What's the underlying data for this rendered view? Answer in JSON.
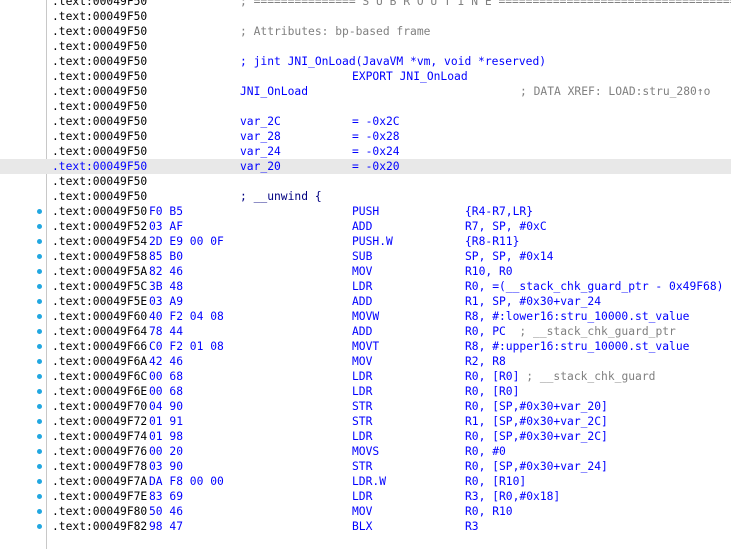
{
  "colors": {
    "address": "#000000",
    "instruction": "#0000ff",
    "comment": "#808080",
    "highlight_row": "#e8e8e8",
    "breakpoint_dot": "#22a7e0"
  },
  "rows": [
    {
      "kind": "text",
      "addr": ".text:00049F50",
      "text": "; =============== S U B R O U T I N E =======================================",
      "cls": "c-gray"
    },
    {
      "kind": "blank",
      "addr": ".text:00049F50"
    },
    {
      "kind": "text",
      "addr": ".text:00049F50",
      "text": "; Attributes: bp-based frame",
      "cls": "c-gray"
    },
    {
      "kind": "blank",
      "addr": ".text:00049F50"
    },
    {
      "kind": "text",
      "addr": ".text:00049F50",
      "text": "; jint JNI_OnLoad(JavaVM *vm, void *reserved)",
      "cls": "c-blue"
    },
    {
      "kind": "instr",
      "addr": ".text:00049F50",
      "bytes": "",
      "mnem": "EXPORT JNI_OnLoad",
      "ops": ""
    },
    {
      "kind": "label",
      "addr": ".text:00049F50",
      "label": "JNI_OnLoad",
      "xref": "; DATA XREF: LOAD:stru_280↑o"
    },
    {
      "kind": "blank",
      "addr": ".text:00049F50"
    },
    {
      "kind": "var",
      "addr": ".text:00049F50",
      "name": "var_2C",
      "val": "= -0x2C"
    },
    {
      "kind": "var",
      "addr": ".text:00049F50",
      "name": "var_28",
      "val": "= -0x28"
    },
    {
      "kind": "var",
      "addr": ".text:00049F50",
      "name": "var_24",
      "val": "= -0x24"
    },
    {
      "kind": "var",
      "addr": ".text:00049F50",
      "name": "var_20",
      "val": "= -0x20",
      "hl": true
    },
    {
      "kind": "blank",
      "addr": ".text:00049F50"
    },
    {
      "kind": "text",
      "addr": ".text:00049F50",
      "text": "; __unwind {",
      "cls": "c-navy"
    },
    {
      "kind": "instr",
      "addr": ".text:00049F50",
      "bytes": "F0 B5",
      "mnem": "PUSH",
      "ops": "{R4-R7,LR}",
      "bp": true
    },
    {
      "kind": "instr",
      "addr": ".text:00049F52",
      "bytes": "03 AF",
      "mnem": "ADD",
      "ops": "R7, SP, #0xC",
      "bp": true
    },
    {
      "kind": "instr",
      "addr": ".text:00049F54",
      "bytes": "2D E9 00 0F",
      "mnem": "PUSH.W",
      "ops": "{R8-R11}",
      "bp": true
    },
    {
      "kind": "instr",
      "addr": ".text:00049F58",
      "bytes": "85 B0",
      "mnem": "SUB",
      "ops": "SP, SP, #0x14",
      "bp": true
    },
    {
      "kind": "instr",
      "addr": ".text:00049F5A",
      "bytes": "82 46",
      "mnem": "MOV",
      "ops": "R10, R0",
      "bp": true
    },
    {
      "kind": "instr",
      "addr": ".text:00049F5C",
      "bytes": "3B 48",
      "mnem": "LDR",
      "ops": "R0, =(__stack_chk_guard_ptr - 0x49F68)",
      "bp": true
    },
    {
      "kind": "instr",
      "addr": ".text:00049F5E",
      "bytes": "03 A9",
      "mnem": "ADD",
      "ops": "R1, SP, #0x30+var_24",
      "bp": true
    },
    {
      "kind": "instr",
      "addr": ".text:00049F60",
      "bytes": "40 F2 04 08",
      "mnem": "MOVW",
      "ops": "R8, #:lower16:stru_10000.st_value",
      "bp": true
    },
    {
      "kind": "instr",
      "addr": ".text:00049F64",
      "bytes": "78 44",
      "mnem": "ADD",
      "ops": "R0, PC",
      "cm": "  ; __stack_chk_guard_ptr",
      "bp": true
    },
    {
      "kind": "instr",
      "addr": ".text:00049F66",
      "bytes": "C0 F2 01 08",
      "mnem": "MOVT",
      "ops": "R8, #:upper16:stru_10000.st_value",
      "bp": true
    },
    {
      "kind": "instr",
      "addr": ".text:00049F6A",
      "bytes": "42 46",
      "mnem": "MOV",
      "ops": "R2, R8",
      "bp": true
    },
    {
      "kind": "instr",
      "addr": ".text:00049F6C",
      "bytes": "00 68",
      "mnem": "LDR",
      "ops": "R0, [R0]",
      "cm": " ; __stack_chk_guard",
      "bp": true
    },
    {
      "kind": "instr",
      "addr": ".text:00049F6E",
      "bytes": "00 68",
      "mnem": "LDR",
      "ops": "R0, [R0]",
      "bp": true
    },
    {
      "kind": "instr",
      "addr": ".text:00049F70",
      "bytes": "04 90",
      "mnem": "STR",
      "ops": "R0, [SP,#0x30+var_20]",
      "bp": true
    },
    {
      "kind": "instr",
      "addr": ".text:00049F72",
      "bytes": "01 91",
      "mnem": "STR",
      "ops": "R1, [SP,#0x30+var_2C]",
      "bp": true
    },
    {
      "kind": "instr",
      "addr": ".text:00049F74",
      "bytes": "01 98",
      "mnem": "LDR",
      "ops": "R0, [SP,#0x30+var_2C]",
      "bp": true
    },
    {
      "kind": "instr",
      "addr": ".text:00049F76",
      "bytes": "00 20",
      "mnem": "MOVS",
      "ops": "R0, #0",
      "bp": true
    },
    {
      "kind": "instr",
      "addr": ".text:00049F78",
      "bytes": "03 90",
      "mnem": "STR",
      "ops": "R0, [SP,#0x30+var_24]",
      "bp": true
    },
    {
      "kind": "instr",
      "addr": ".text:00049F7A",
      "bytes": "DA F8 00 00",
      "mnem": "LDR.W",
      "ops": "R0, [R10]",
      "bp": true
    },
    {
      "kind": "instr",
      "addr": ".text:00049F7E",
      "bytes": "83 69",
      "mnem": "LDR",
      "ops": "R3, [R0,#0x18]",
      "bp": true
    },
    {
      "kind": "instr",
      "addr": ".text:00049F80",
      "bytes": "50 46",
      "mnem": "MOV",
      "ops": "R0, R10",
      "bp": true
    },
    {
      "kind": "instr",
      "addr": ".text:00049F82",
      "bytes": "98 47",
      "mnem": "BLX",
      "ops": "R3",
      "bp": true
    }
  ]
}
